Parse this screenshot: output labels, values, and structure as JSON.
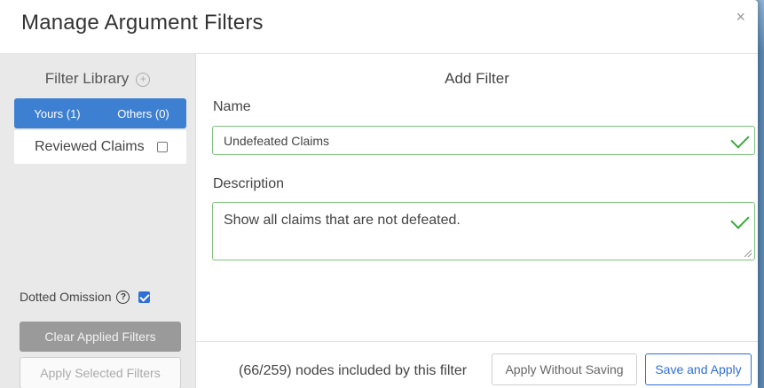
{
  "modal": {
    "title": "Manage Argument Filters",
    "close_label": "×"
  },
  "sidebar": {
    "library_title": "Filter Library",
    "add_symbol": "+",
    "tabs": [
      {
        "label": "Yours (1)"
      },
      {
        "label": "Others (0)"
      }
    ],
    "filters": [
      {
        "label": "Reviewed Claims",
        "checked": false
      }
    ],
    "dotted_omission": {
      "label": "Dotted Omission",
      "help_symbol": "?",
      "checked": true
    },
    "clear_label": "Clear Applied Filters",
    "apply_selected_label": "Apply Selected Filters"
  },
  "main": {
    "title": "Add Filter",
    "name_label": "Name",
    "name_value": "Undefeated Claims",
    "description_label": "Description",
    "description_value": "Show all claims that are not defeated."
  },
  "footer": {
    "nodes_text": "(66/259) nodes included by this filter",
    "apply_without_saving_label": "Apply Without Saving",
    "save_and_apply_label": "Save and Apply"
  },
  "colors": {
    "accent": "#3d7fd1",
    "valid": "#3aa93a",
    "background": "#5b88b3"
  }
}
